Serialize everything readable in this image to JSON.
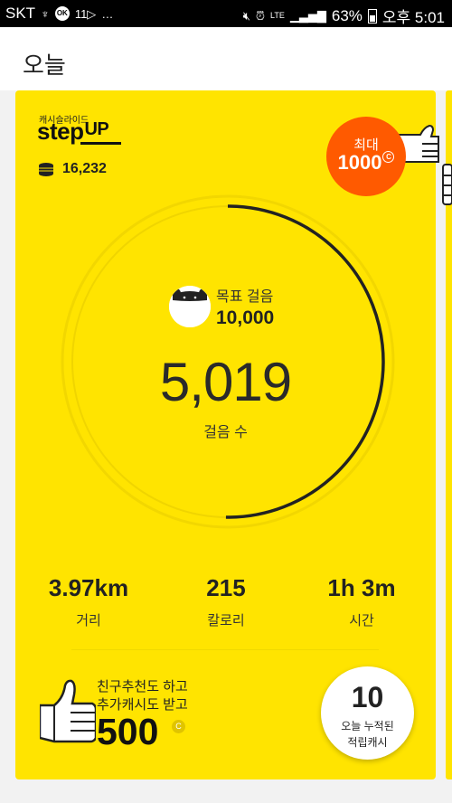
{
  "statusbar": {
    "carrier": "SKT",
    "battery": "63%",
    "time": "오후 5:01",
    "network": "LTE"
  },
  "header": {
    "title": "오늘"
  },
  "card": {
    "logo_small": "캐시슬라이드",
    "logo_main": "step",
    "logo_up": "UP",
    "coins": "16,232",
    "max_badge": {
      "label": "최대",
      "value": "1000",
      "currency_mark": "C"
    },
    "goal": {
      "label": "목표 걸음",
      "value": "10,000"
    },
    "steps": {
      "value": "5,019",
      "label": "걸음 수",
      "progress": 0.5019
    },
    "stats": {
      "distance": {
        "value": "3.97km",
        "label": "거리"
      },
      "calories": {
        "value": "215",
        "label": "칼로리"
      },
      "time": {
        "value": "1h 3m",
        "label": "시간"
      }
    },
    "promo": {
      "line1": "친구추천도 하고",
      "line2": "추가캐시도 받고",
      "amount": "500",
      "currency_mark": "C"
    },
    "earned": {
      "value": "10",
      "label1": "오늘 누적된",
      "label2": "적립캐시"
    }
  },
  "colors": {
    "card_bg": "#ffe400",
    "badge_orange": "#ff5a00",
    "ring_track": "#f0d500",
    "ring_progress": "#222222"
  }
}
